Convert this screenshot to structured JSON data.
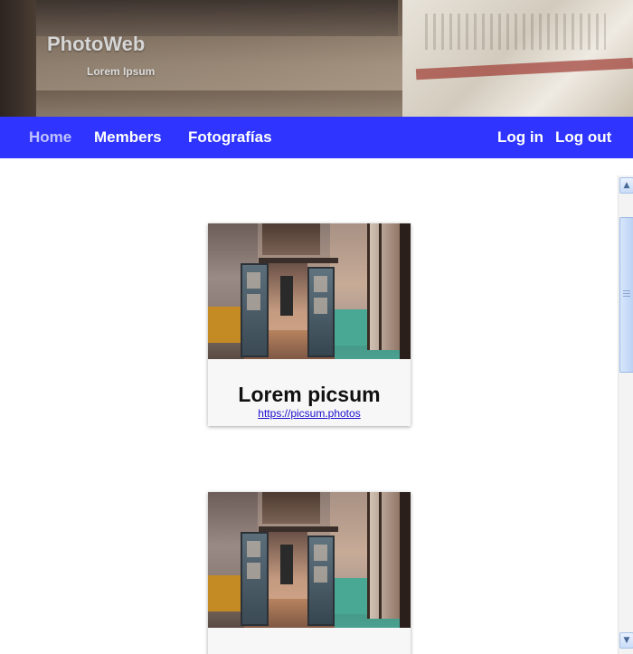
{
  "header": {
    "brand": "PhotoWeb",
    "tagline": "Lorem Ipsum"
  },
  "nav": {
    "left": [
      {
        "label": "Home",
        "active": true
      },
      {
        "label": "Members",
        "active": false
      },
      {
        "label": "Fotografías",
        "active": false
      }
    ],
    "right": [
      {
        "label": "Log in"
      },
      {
        "label": "Log out"
      }
    ]
  },
  "cards": [
    {
      "title": "Lorem picsum",
      "link": "https://picsum.photos"
    },
    {
      "title": "",
      "link": ""
    }
  ],
  "colors": {
    "navbar": "#2f35ff",
    "active_nav": "#bfc2ff",
    "link": "#1a0dcc"
  },
  "icons": {
    "scroll_up": "scroll-up-arrow-icon",
    "scroll_down": "scroll-down-arrow-icon"
  }
}
